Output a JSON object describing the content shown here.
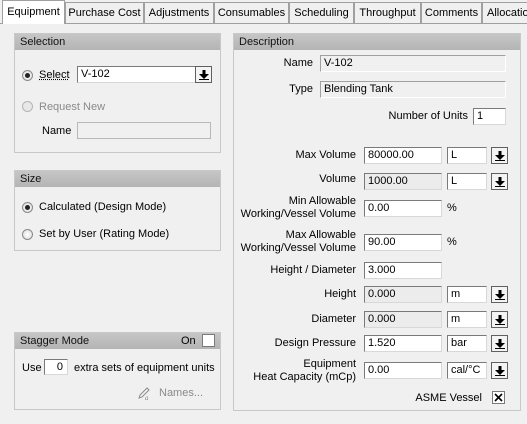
{
  "tabs": [
    {
      "label": "Equipment"
    },
    {
      "label": "Purchase Cost"
    },
    {
      "label": "Adjustments"
    },
    {
      "label": "Consumables"
    },
    {
      "label": "Scheduling"
    },
    {
      "label": "Throughput"
    },
    {
      "label": "Comments"
    },
    {
      "label": "Allocatio"
    }
  ],
  "selection": {
    "header": "Selection",
    "select_label": "Select",
    "select_value": "V-102",
    "request_new_label": "Request New",
    "name_label": "Name",
    "name_value": ""
  },
  "size": {
    "header": "Size",
    "calculated_label": "Calculated (Design Mode)",
    "set_by_user_label": "Set by User (Rating Mode)"
  },
  "stagger": {
    "header": "Stagger Mode",
    "on_label": "On",
    "use_label": "Use",
    "count_value": "0",
    "suffix_label": "extra sets of equipment units",
    "names_button": "Names..."
  },
  "description": {
    "header": "Description",
    "name_label": "Name",
    "name_value": "V-102",
    "type_label": "Type",
    "type_value": "Blending Tank",
    "units_label": "Number of Units",
    "units_value": "1",
    "max_volume_label": "Max Volume",
    "max_volume_value": "80000.00",
    "max_volume_unit": "L",
    "volume_label": "Volume",
    "volume_value": "1000.00",
    "volume_unit": "L",
    "min_allow_label_1": "Min Allowable",
    "min_allow_label_2": "Working/Vessel Volume",
    "min_allow_value": "0.00",
    "min_allow_unit": "%",
    "max_allow_label_1": "Max Allowable",
    "max_allow_label_2": "Working/Vessel Volume",
    "max_allow_value": "90.00",
    "max_allow_unit": "%",
    "hd_label": "Height / Diameter",
    "hd_value": "3.000",
    "height_label": "Height",
    "height_value": "0.000",
    "height_unit": "m",
    "diameter_label": "Diameter",
    "diameter_value": "0.000",
    "diameter_unit": "m",
    "pressure_label": "Design Pressure",
    "pressure_value": "1.520",
    "pressure_unit": "bar",
    "heatcap_label_1": "Equipment",
    "heatcap_label_2": "Heat Capacity (mCp)",
    "heatcap_value": "0.00",
    "heatcap_unit": "cal/°C",
    "asme_label": "ASME Vessel"
  },
  "colors": {
    "header_gray": "#bdbdbd",
    "panel_bg": "#f0f0f0"
  },
  "icons": {
    "dropdown": "dropdown-arrow-icon",
    "checkbox_mark": "x-mark-icon",
    "names": "pencil-edit-icon"
  }
}
